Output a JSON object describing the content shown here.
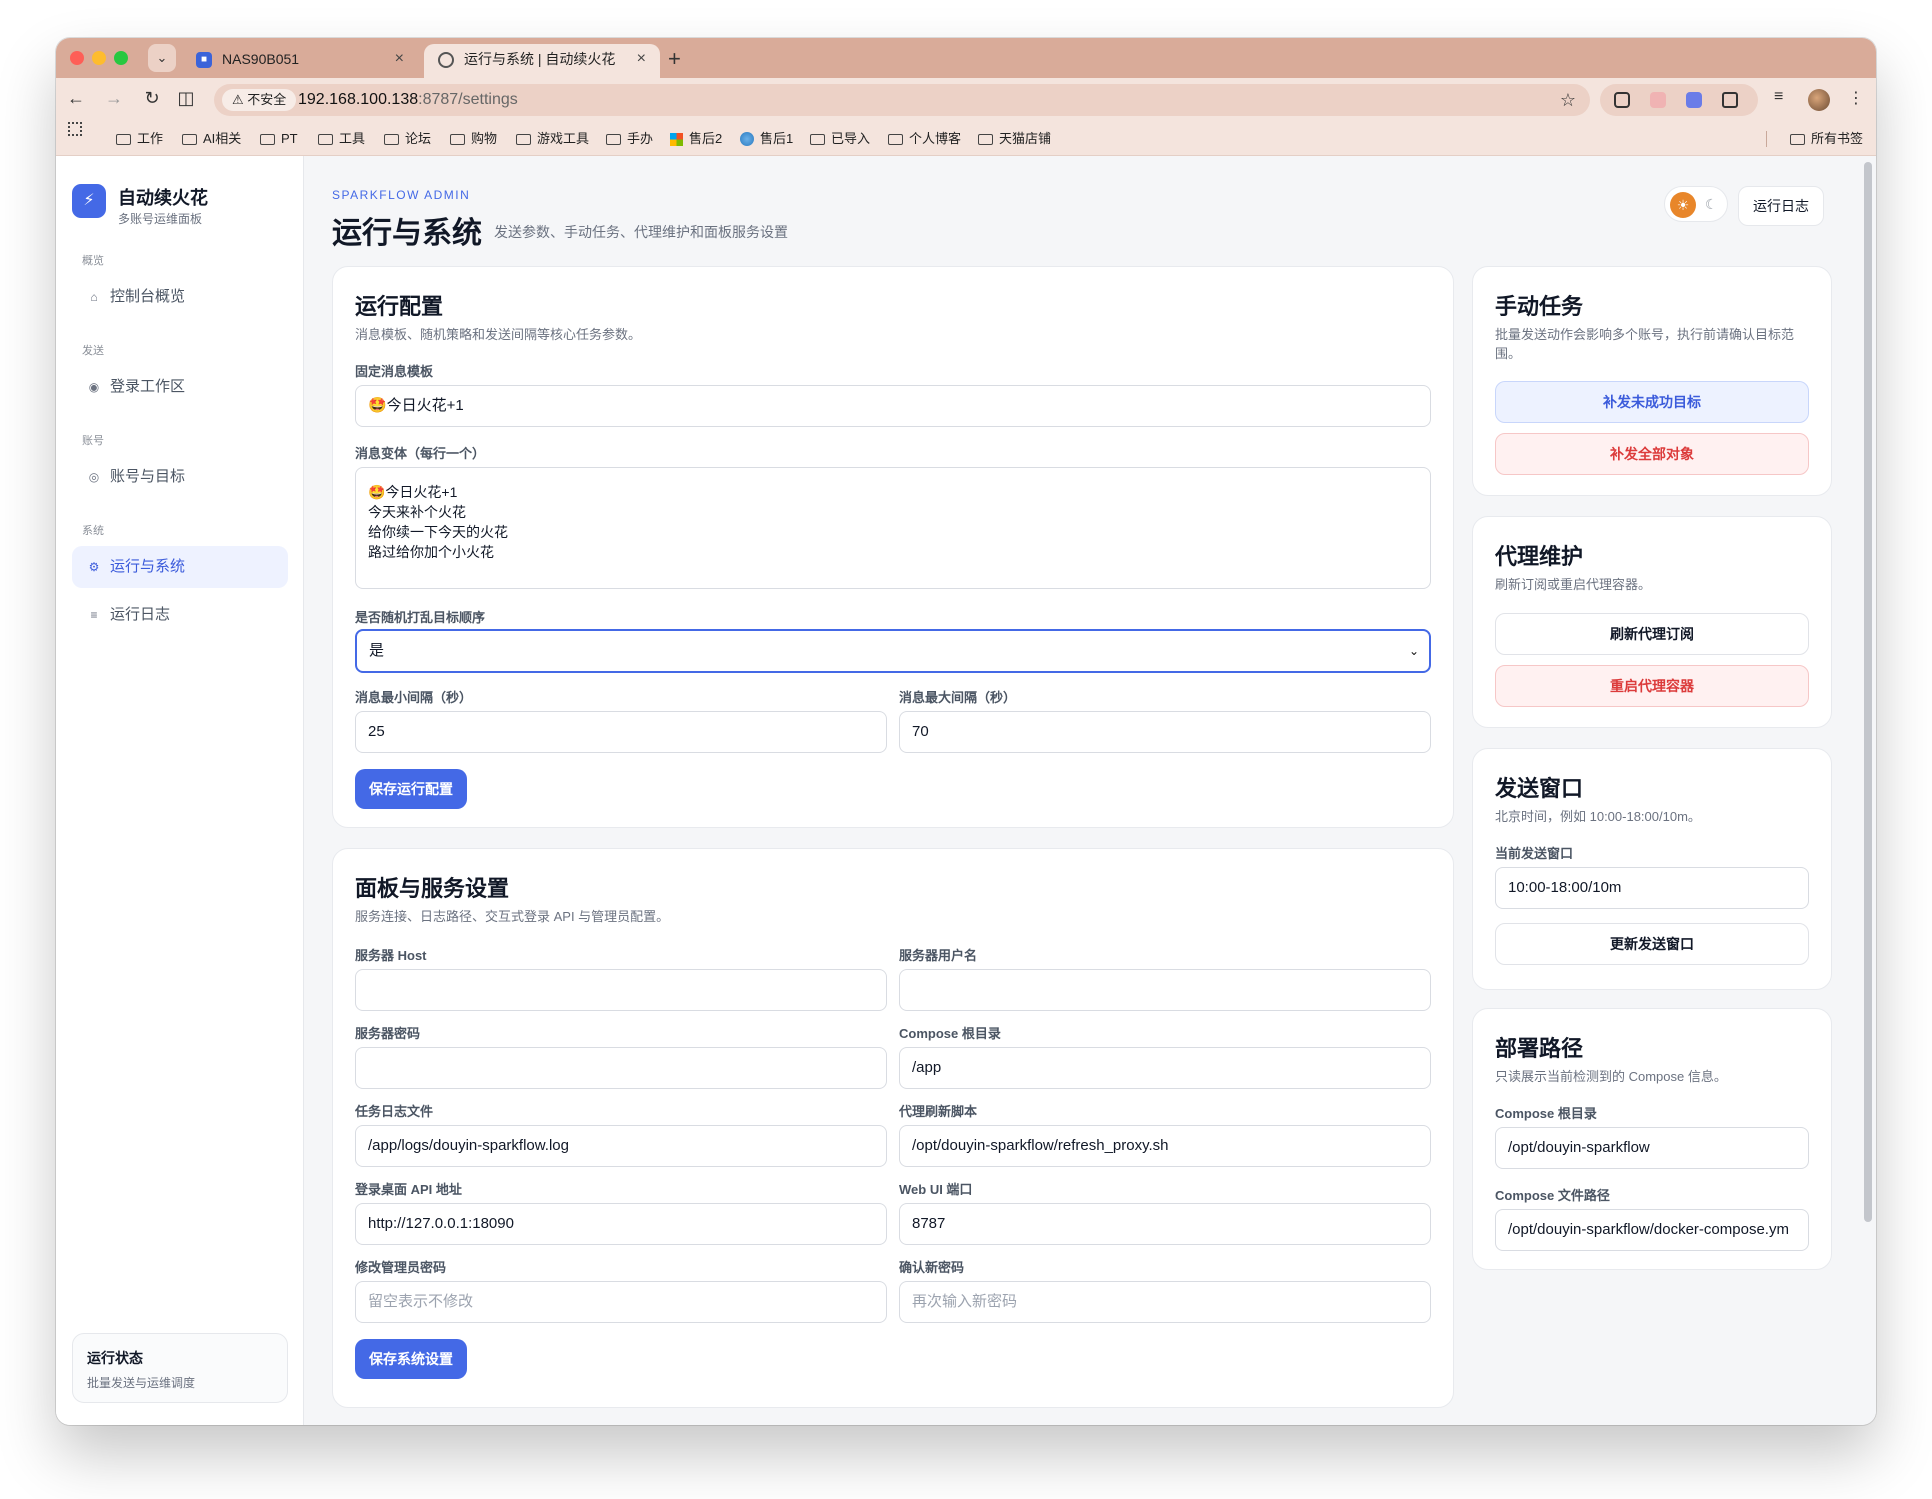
{
  "browser": {
    "tabs": [
      {
        "title": "NAS90B051",
        "active": false
      },
      {
        "title": "运行与系统 | 自动续火花",
        "active": true
      }
    ],
    "security_label": "不安全",
    "url_host": "192.168.100.138",
    "url_path": ":8787/settings",
    "bookmarks": [
      "工作",
      "AI相关",
      "PT",
      "工具",
      "论坛",
      "购物",
      "游戏工具",
      "手办",
      "售后2",
      "售后1",
      "已导入",
      "个人博客",
      "天猫店铺"
    ],
    "all_bookmarks": "所有书签"
  },
  "sidebar": {
    "brand_title": "自动续火花",
    "brand_subtitle": "多账号运维面板",
    "sections": {
      "overview": "概览",
      "send": "发送",
      "account": "账号",
      "system": "系统"
    },
    "items": {
      "dashboard": "控制台概览",
      "login": "登录工作区",
      "accounts": "账号与目标",
      "settings": "运行与系统",
      "logs": "运行日志"
    },
    "status_title": "运行状态",
    "status_desc": "批量发送与运维调度"
  },
  "header": {
    "eyebrow": "SPARKFLOW ADMIN",
    "title": "运行与系统",
    "description": "发送参数、手动任务、代理维护和面板服务设置",
    "log_button": "运行日志",
    "theme": "light"
  },
  "run_config": {
    "title": "运行配置",
    "description": "消息模板、随机策略和发送间隔等核心任务参数。",
    "template_label": "固定消息模板",
    "template_value": "🤩今日火花+1",
    "variants_label": "消息变体（每行一个）",
    "variants": [
      "🤩今日火花+1",
      "今天来补个火花",
      "给你续一下今天的火花",
      "路过给你加个小火花"
    ],
    "shuffle_label": "是否随机打乱目标顺序",
    "shuffle_value": "是",
    "min_interval_label": "消息最小间隔（秒）",
    "min_interval_value": "25",
    "max_interval_label": "消息最大间隔（秒）",
    "max_interval_value": "70",
    "save_button": "保存运行配置"
  },
  "panel_service": {
    "title": "面板与服务设置",
    "description": "服务连接、日志路径、交互式登录 API 与管理员配置。",
    "server_host_label": "服务器 Host",
    "server_host_value": "",
    "server_user_label": "服务器用户名",
    "server_user_value": "",
    "server_password_label": "服务器密码",
    "server_password_value": "",
    "compose_root_label": "Compose 根目录",
    "compose_root_value": "/app",
    "task_log_label": "任务日志文件",
    "task_log_value": "/app/logs/douyin-sparkflow.log",
    "proxy_script_label": "代理刷新脚本",
    "proxy_script_value": "/opt/douyin-sparkflow/refresh_proxy.sh",
    "login_api_label": "登录桌面 API 地址",
    "login_api_value": "http://127.0.0.1:18090",
    "webui_port_label": "Web UI 端口",
    "webui_port_value": "8787",
    "admin_password_label": "修改管理员密码",
    "admin_password_placeholder": "留空表示不修改",
    "confirm_password_label": "确认新密码",
    "confirm_password_placeholder": "再次输入新密码",
    "save_button": "保存系统设置"
  },
  "manual_tasks": {
    "title": "手动任务",
    "description": "批量发送动作会影响多个账号，执行前请确认目标范围。",
    "retry_failed_button": "补发未成功目标",
    "retry_all_button": "补发全部对象"
  },
  "proxy": {
    "title": "代理维护",
    "description": "刷新订阅或重启代理容器。",
    "refresh_button": "刷新代理订阅",
    "restart_button": "重启代理容器"
  },
  "send_window": {
    "title": "发送窗口",
    "description": "北京时间，例如 10:00-18:00/10m。",
    "current_label": "当前发送窗口",
    "current_value": "10:00-18:00/10m",
    "update_button": "更新发送窗口"
  },
  "deploy": {
    "title": "部署路径",
    "description": "只读展示当前检测到的 Compose 信息。",
    "root_label": "Compose 根目录",
    "root_value": "/opt/douyin-sparkflow",
    "file_label": "Compose 文件路径",
    "file_value": "/opt/douyin-sparkflow/docker-compose.ym"
  }
}
